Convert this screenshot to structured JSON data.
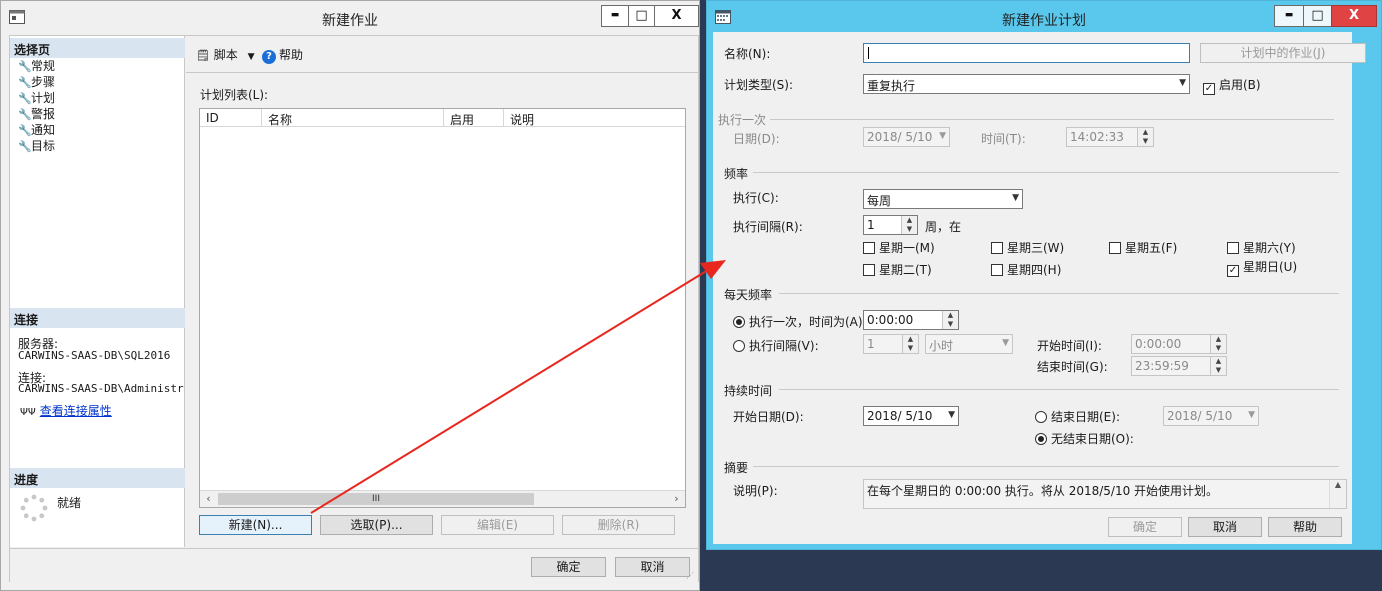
{
  "left_window": {
    "title": "新建作业",
    "controls": {
      "minimize": "▬",
      "maximize": "□",
      "close": "X"
    },
    "sidebar": {
      "select_page_header": "选择页",
      "items": [
        {
          "label": "常规",
          "icon": "wrench-icon"
        },
        {
          "label": "步骤",
          "icon": "wrench-icon"
        },
        {
          "label": "计划",
          "icon": "wrench-icon"
        },
        {
          "label": "警报",
          "icon": "wrench-icon"
        },
        {
          "label": "通知",
          "icon": "wrench-icon"
        },
        {
          "label": "目标",
          "icon": "wrench-icon"
        }
      ],
      "connection_header": "连接",
      "server_label": "服务器:",
      "server_value": "CARWINS-SAAS-DB\\SQL2016",
      "connection_label": "连接:",
      "connection_value": "CARWINS-SAAS-DB\\Administrator",
      "view_connection_link": "查看连接属性",
      "progress_header": "进度",
      "progress_status": "就绪"
    },
    "toolbar": {
      "script_label": "脚本",
      "help_label": "帮助"
    },
    "schedule_list_label": "计划列表(L):",
    "list_columns": [
      "ID",
      "名称",
      "启用",
      "说明"
    ],
    "scroll_thumb": "III",
    "buttons": {
      "new": "新建(N)...",
      "pick": "选取(P)...",
      "edit": "编辑(E)",
      "delete": "删除(R)"
    },
    "ok": "确定",
    "cancel": "取消"
  },
  "right_window": {
    "title": "新建作业计划",
    "controls": {
      "minimize": "▬",
      "maximize": "□",
      "close": "X"
    },
    "name_label": "名称(N):",
    "name_value": "",
    "jobs_in_schedule_button": "计划中的作业(J)",
    "schedule_type_label": "计划类型(S):",
    "schedule_type_value": "重复执行",
    "enabled_label": "启用(B)",
    "enabled_checked": true,
    "one_time_section": "执行一次",
    "one_time_date_label": "日期(D):",
    "one_time_date_value": "2018/ 5/10",
    "one_time_time_label": "时间(T):",
    "one_time_time_value": "14:02:33",
    "frequency_section": "频率",
    "occurs_label": "执行(C):",
    "occurs_value": "每周",
    "recurs_label": "执行间隔(R):",
    "recurs_value": "1",
    "recurs_suffix": "周，在",
    "weekdays": [
      {
        "label": "星期一(M)",
        "checked": false
      },
      {
        "label": "星期三(W)",
        "checked": false
      },
      {
        "label": "星期五(F)",
        "checked": false
      },
      {
        "label": "星期六(Y)",
        "checked": false
      },
      {
        "label": "星期二(T)",
        "checked": false
      },
      {
        "label": "星期四(H)",
        "checked": false
      },
      {
        "label": "星期日(U)",
        "checked": true
      }
    ],
    "daily_section": "每天频率",
    "once_at_label": "执行一次，时间为(A):",
    "once_at_value": "0:00:00",
    "every_label": "执行间隔(V):",
    "every_value": "1",
    "every_unit": "小时",
    "start_time_label": "开始时间(I):",
    "start_time_value": "0:00:00",
    "end_time_label": "结束时间(G):",
    "end_time_value": "23:59:59",
    "duration_section": "持续时间",
    "start_date_label": "开始日期(D):",
    "start_date_value": "2018/ 5/10",
    "end_date_label": "结束日期(E):",
    "end_date_value": "2018/ 5/10",
    "no_end_label": "无结束日期(O):",
    "summary_section": "摘要",
    "description_label": "说明(P):",
    "description_value": "在每个星期日的 0:00:00 执行。将从 2018/5/10 开始使用计划。",
    "ok": "确定",
    "cancel": "取消",
    "help": "帮助"
  },
  "colors": {
    "active_title": "#5ac8ec",
    "arrow": "#e8271f",
    "header_band": "#d9e4f1"
  }
}
